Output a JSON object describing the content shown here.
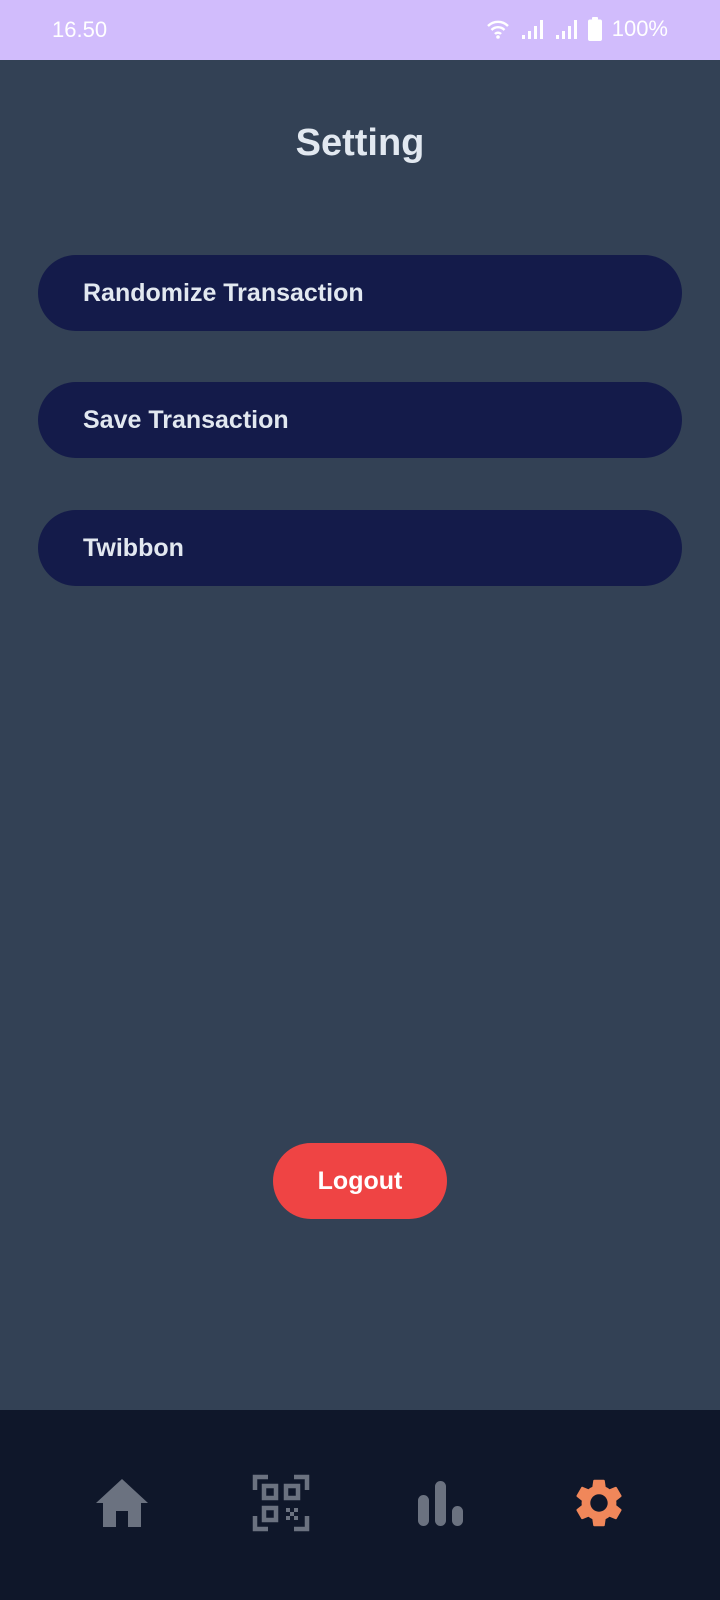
{
  "status_bar": {
    "time": "16.50",
    "battery": "100%",
    "icons": [
      "wifi-icon",
      "signal-icon",
      "signal-icon",
      "battery-icon"
    ]
  },
  "page": {
    "title": "Setting"
  },
  "menu": {
    "items": [
      {
        "label": "Randomize Transaction"
      },
      {
        "label": "Save Transaction"
      },
      {
        "label": "Twibbon"
      }
    ]
  },
  "logout": {
    "label": "Logout"
  },
  "bottom_nav": {
    "items": [
      {
        "icon": "home-icon",
        "active": false
      },
      {
        "icon": "qr-code-icon",
        "active": false
      },
      {
        "icon": "bar-chart-icon",
        "active": false
      },
      {
        "icon": "gear-icon",
        "active": true
      }
    ]
  },
  "colors": {
    "background": "#334155",
    "status_bar": "#d1bcfc",
    "menu_button": "#141b4a",
    "logout_button": "#ef4444",
    "nav_background": "#0f172a",
    "nav_inactive": "#6b7280",
    "nav_active": "#f0875a"
  }
}
